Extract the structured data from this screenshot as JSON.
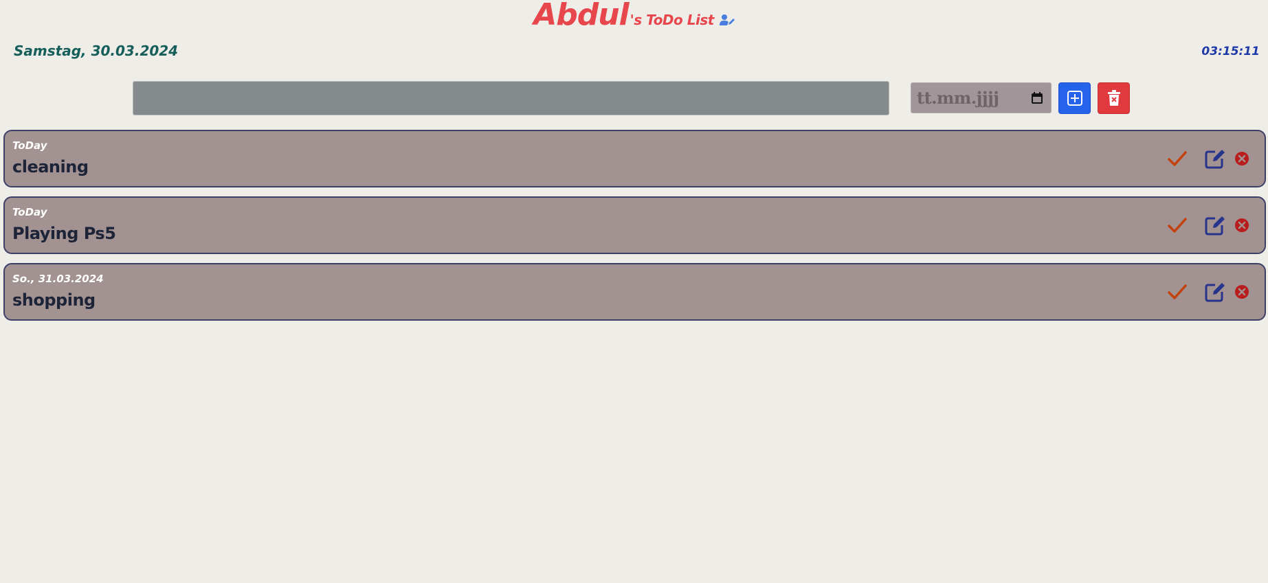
{
  "header": {
    "owner_name": "Abdul",
    "title_suffix": "'s ToDo List",
    "user_icon": "user-pen-icon"
  },
  "date_display": "Samstag, 30.03.2024",
  "time_display": "03:15:11",
  "form": {
    "task_input_value": "",
    "task_input_placeholder": "",
    "date_placeholder": "tt.mm.jjjj",
    "add_button_icon": "plus-square-icon",
    "clear_button_icon": "trash-x-icon"
  },
  "todos": [
    {
      "date_label": "ToDay",
      "text": "cleaning"
    },
    {
      "date_label": "ToDay",
      "text": "Playing Ps5"
    },
    {
      "date_label": "So., 31.03.2024",
      "text": "shopping"
    }
  ],
  "colors": {
    "background": "#efede8",
    "title": "#e8464d",
    "date": "#155e5a",
    "time": "#1e3aa8",
    "add_button": "#2563eb",
    "clear_button": "#e03a3f",
    "item_bg": "#a39292",
    "item_border": "#3b3f66",
    "check": "#c2410c",
    "edit": "#27348b",
    "delete": "#b91c1c"
  }
}
